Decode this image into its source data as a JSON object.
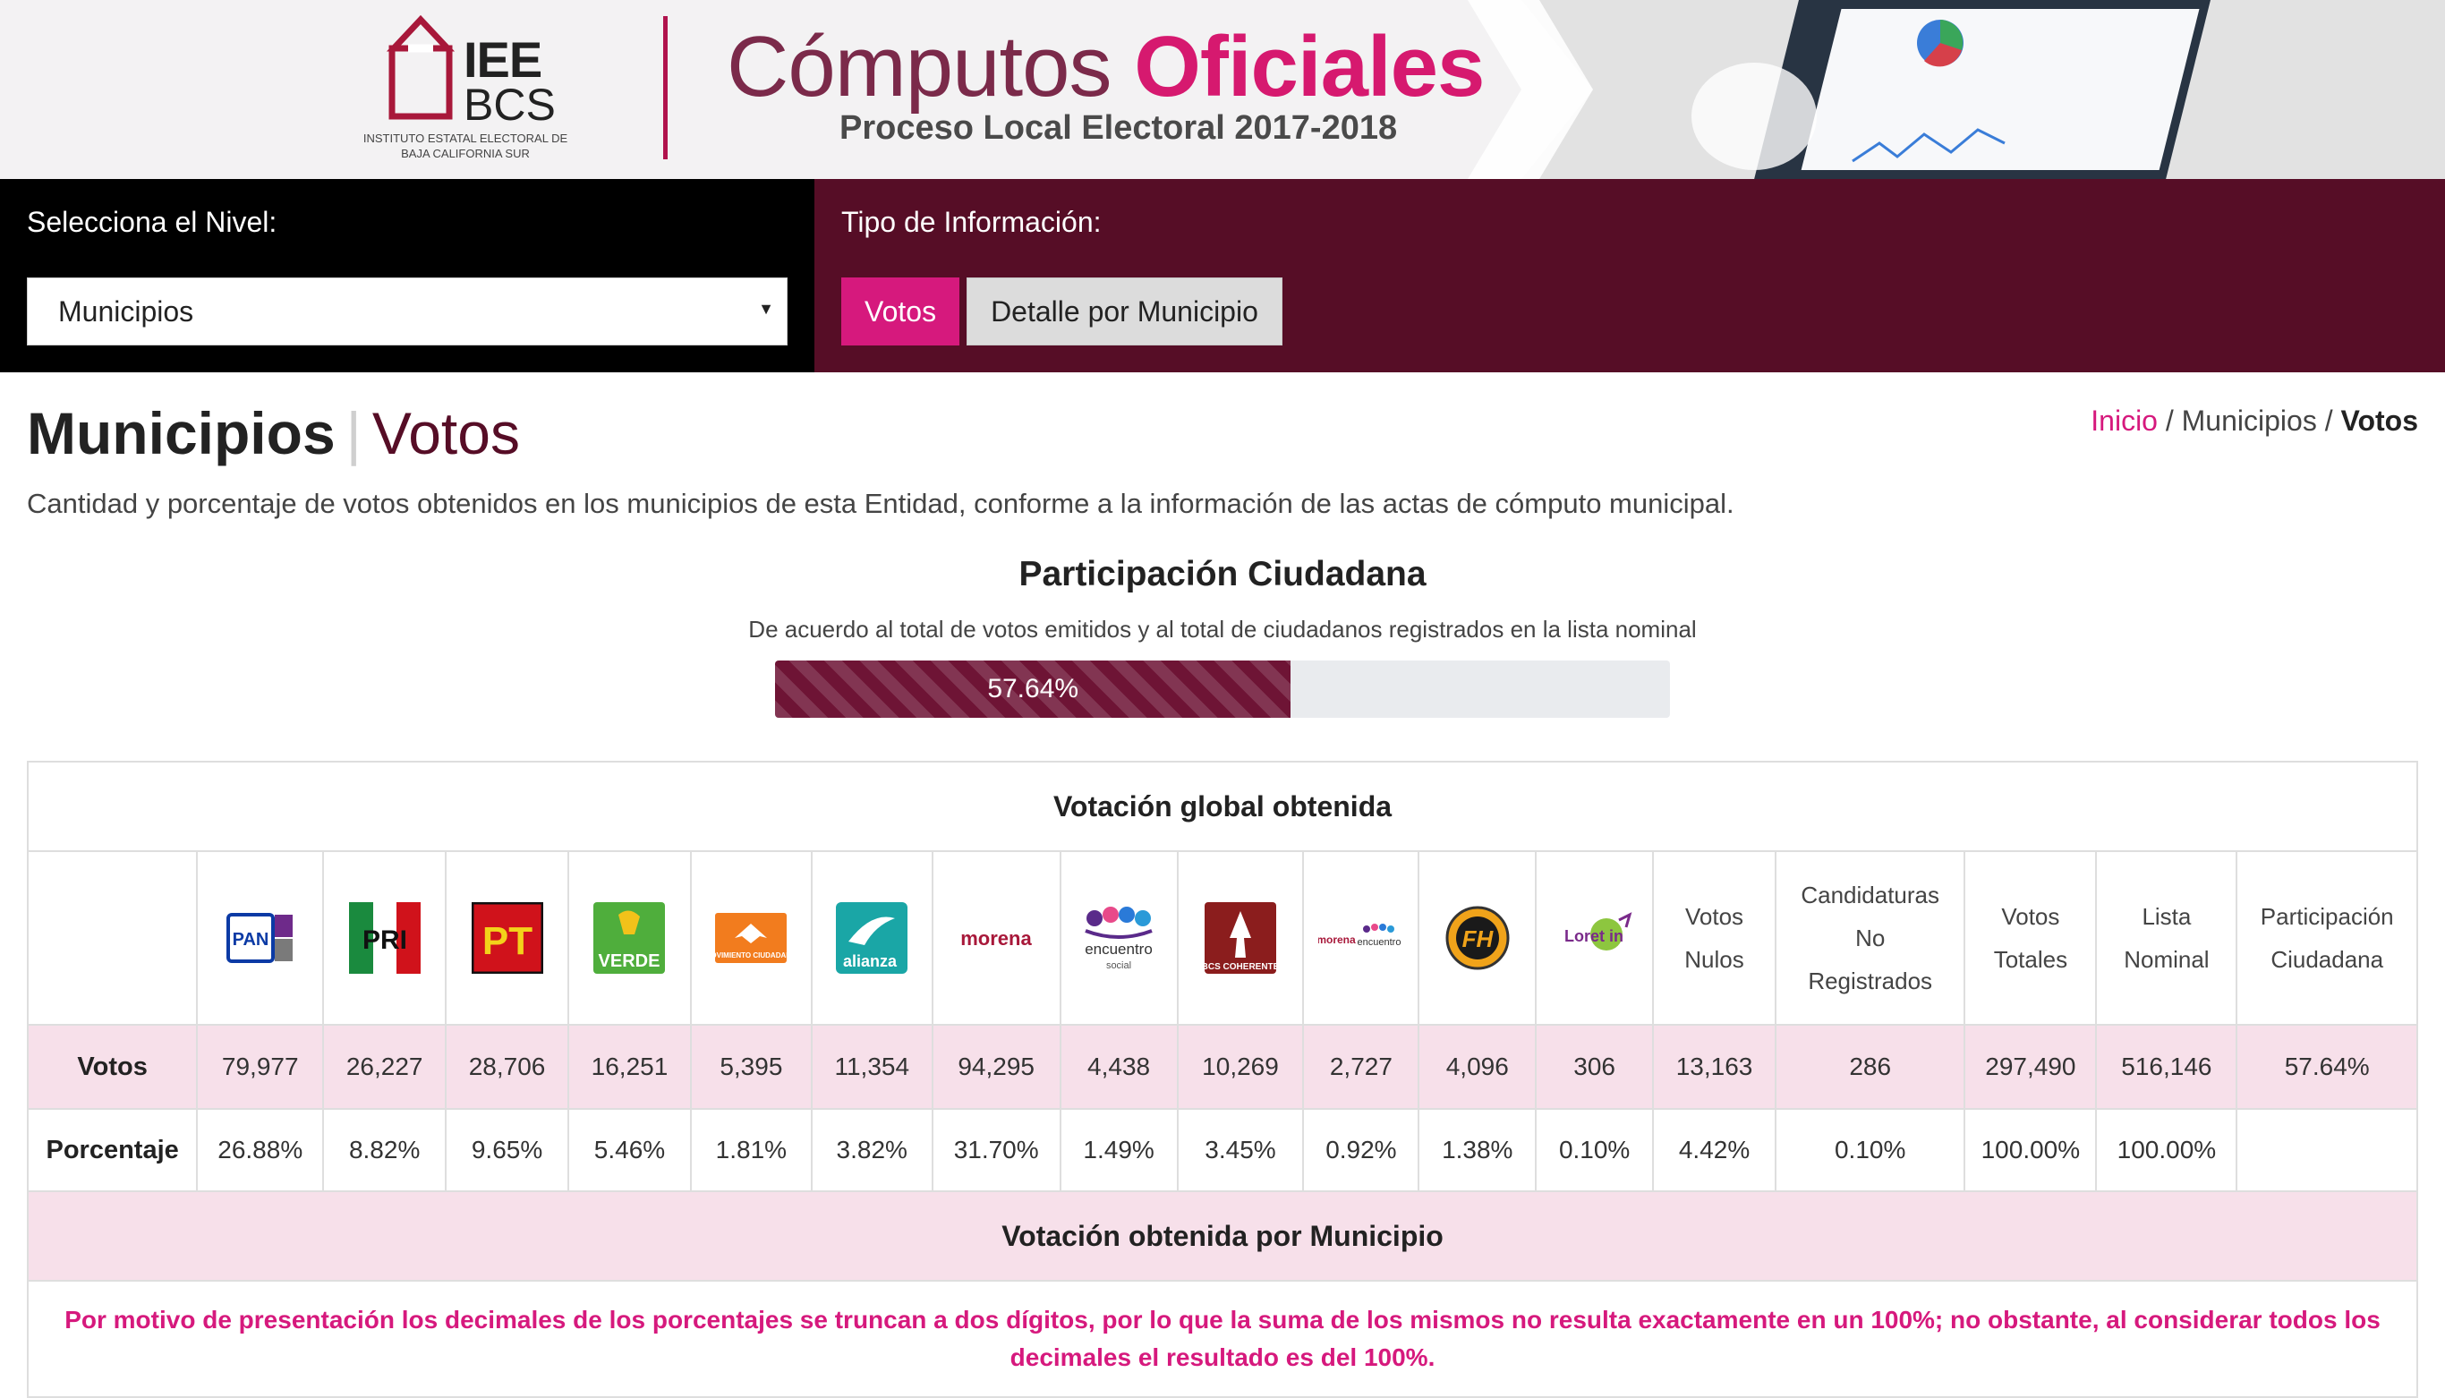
{
  "banner": {
    "logo_line1": "IEE",
    "logo_line2": "BCS",
    "logo_caption": "Instituto Estatal Electoral de Baja California Sur",
    "title_part1": "Cómputos",
    "title_part2": "Oficiales",
    "subtitle": "Proceso Local Electoral 2017-2018"
  },
  "nivel": {
    "label": "Selecciona el Nivel:",
    "selected": "Municipios"
  },
  "tipo": {
    "label": "Tipo de Información:",
    "btn_votos": "Votos",
    "btn_detalle": "Detalle por Municipio"
  },
  "heading": {
    "title": "Municipios",
    "separator": "|",
    "subtitle": "Votos",
    "intro": "Cantidad y porcentaje de votos obtenidos en los municipios de esta Entidad, conforme a la información de las actas de cómputo municipal."
  },
  "breadcrumb": {
    "home": "Inicio",
    "sep": "/",
    "level": "Municipios",
    "current": "Votos"
  },
  "participacion": {
    "title": "Participación Ciudadana",
    "subtitle": "De acuerdo al total de votos emitidos y al total de ciudadanos registrados en la lista nominal",
    "value_text": "57.64%",
    "value": 57.64
  },
  "table": {
    "title": "Votación global obtenida",
    "parties": [
      {
        "icon": "pan-logo",
        "color": "#0b3aa5"
      },
      {
        "icon": "pri-logo",
        "color": "#d0121b"
      },
      {
        "icon": "pt-logo",
        "color": "#d0121b"
      },
      {
        "icon": "verde-logo",
        "color": "#4fae3c"
      },
      {
        "icon": "movimiento-ciudadano-logo",
        "color": "#f27c1e"
      },
      {
        "icon": "nueva-alianza-logo",
        "color": "#1aa6a6"
      },
      {
        "icon": "morena-logo",
        "color": "#a8183a"
      },
      {
        "icon": "encuentro-social-logo",
        "color": "#5a2a8a"
      },
      {
        "icon": "bcs-coherente-logo",
        "color": "#8b1d1d"
      },
      {
        "icon": "coalicion-morena-encuentro-logo",
        "color": "#a8183a"
      },
      {
        "icon": "fh-logo",
        "color": "#f0a31a"
      },
      {
        "icon": "loreto-in-logo",
        "color": "#8dc63f"
      }
    ],
    "text_headers": [
      {
        "key": "nulos",
        "lines": [
          "Votos",
          "Nulos"
        ]
      },
      {
        "key": "noreg",
        "lines": [
          "Candidaturas",
          "No",
          "Registrados"
        ]
      },
      {
        "key": "totales",
        "lines": [
          "Votos",
          "Totales"
        ]
      },
      {
        "key": "lista",
        "lines": [
          "Lista",
          "Nominal"
        ]
      },
      {
        "key": "participacion",
        "lines": [
          "Participación",
          "Ciudadana"
        ]
      }
    ],
    "rows": [
      {
        "label": "Votos",
        "cells": [
          "79,977",
          "26,227",
          "28,706",
          "16,251",
          "5,395",
          "11,354",
          "94,295",
          "4,438",
          "10,269",
          "2,727",
          "4,096",
          "306",
          "13,163",
          "286",
          "297,490",
          "516,146",
          "57.64%"
        ]
      },
      {
        "label": "Porcentaje",
        "cells": [
          "26.88%",
          "8.82%",
          "9.65%",
          "5.46%",
          "1.81%",
          "3.82%",
          "31.70%",
          "1.49%",
          "3.45%",
          "0.92%",
          "1.38%",
          "0.10%",
          "4.42%",
          "0.10%",
          "100.00%",
          "100.00%",
          ""
        ]
      }
    ],
    "municipio_title": "Votación obtenida por Municipio",
    "note": "Por motivo de presentación los decimales de los porcentajes se truncan a dos dígitos, por lo que la suma de los mismos no resulta exactamente en un 100%; no obstante, al considerar todos los decimales el resultado es del 100%."
  },
  "logo_texts": {
    "pan": "PAN",
    "pri": "PRI",
    "pt": "PT",
    "verde": "VERDE",
    "mc": "MOVIMIENTO CIUDADANO",
    "na": "alianza",
    "morena": "morena",
    "es": "encuentro",
    "es2": "social",
    "bcs": "BCS COHERENTE",
    "coal1": "morena",
    "coal2": "encuentro",
    "fh": "FH",
    "loreto": "Loret in"
  }
}
